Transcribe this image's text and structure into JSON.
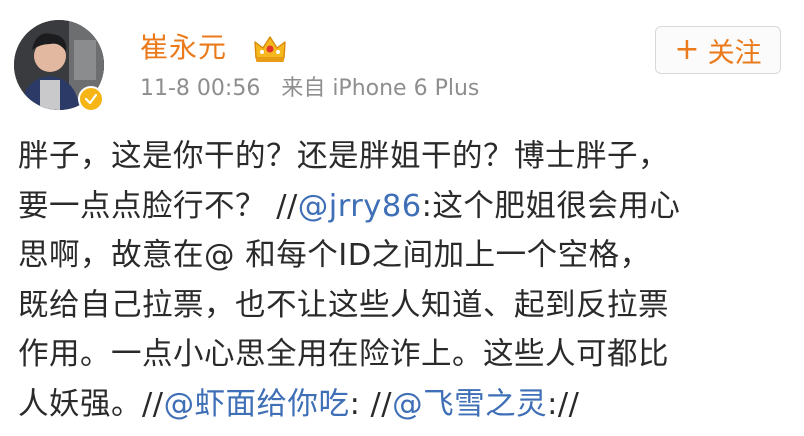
{
  "post": {
    "username": "崔永元",
    "timestamp": "11-8 00:56",
    "source": "来自 iPhone 6 Plus",
    "follow_plus": "+",
    "follow_label": "关注",
    "icons": {
      "avatar": "user-avatar",
      "badge": "verified-badge-icon",
      "crown": "crown-icon"
    },
    "colors": {
      "username": "#ea7a1a",
      "mention": "#3f6fb6",
      "meta": "#8e8e8e",
      "text": "#2a2a2a",
      "badge": "#f6b515"
    },
    "lines": {
      "l1": "胖子，这是你干的？还是胖姐干的？博士胖子，",
      "l2a": "要一点点脸行不？ //",
      "l2m": "@jrry86",
      "l2b": ":这个肥姐很会用心",
      "l3": "思啊，故意在@ 和每个ID之间加上一个空格，",
      "l4": "既给自己拉票，也不让这些人知道、起到反拉票",
      "l5": "作用。一点小心思全用在险诈上。这些人可都比",
      "l6a": "人妖强。//",
      "l6m1": "@虾面给你吃",
      "l6b": ": //",
      "l6m2": "@飞雪之灵",
      "l6c": "://"
    }
  }
}
